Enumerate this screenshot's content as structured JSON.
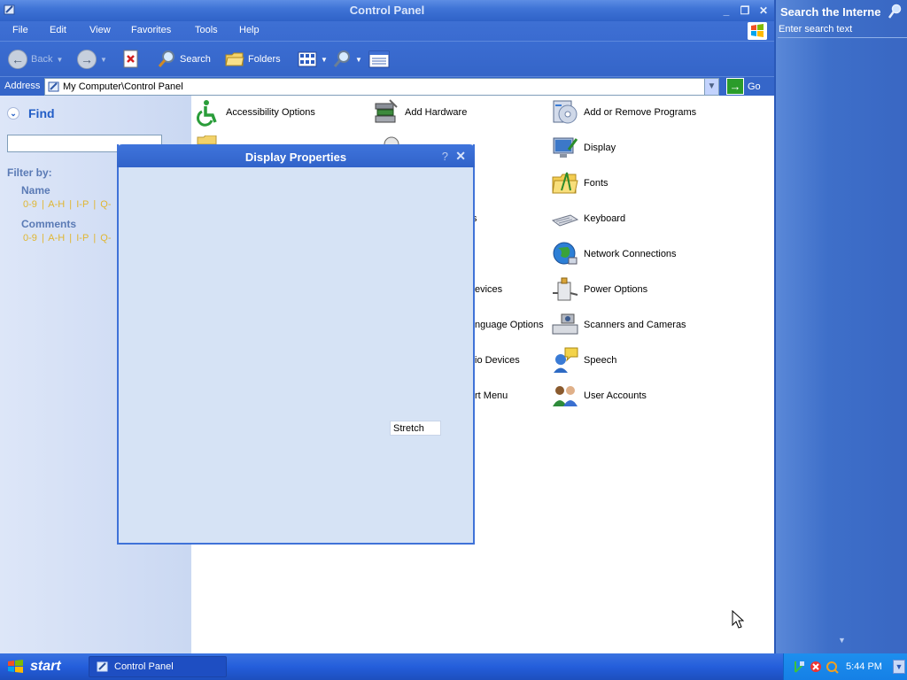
{
  "window": {
    "title": "Control Panel",
    "minimize": "_",
    "restore": "❐",
    "close": "✕"
  },
  "menu": [
    "File",
    "Edit",
    "View",
    "Favorites",
    "Tools",
    "Help"
  ],
  "toolbar": {
    "back": "Back",
    "search": "Search",
    "folders": "Folders"
  },
  "address": {
    "label": "Address",
    "value": "My Computer\\Control Panel",
    "go": "Go"
  },
  "left_pane": {
    "find": "Find",
    "filter_by": "Filter by:",
    "groups": [
      {
        "title": "Name",
        "links": [
          "0-9",
          "A-H",
          "I-P",
          "Q-"
        ]
      },
      {
        "title": "Comments",
        "links": [
          "0-9",
          "A-H",
          "I-P",
          "Q-"
        ]
      }
    ],
    "separator": "|"
  },
  "items": {
    "col1": [
      "Accessibility Options"
    ],
    "col2": [
      "Add Hardware",
      "evices",
      "nguage Options",
      "io Devices",
      "rt Menu"
    ],
    "col2_partial_s": "s",
    "col3": [
      "Add or Remove Programs",
      "Display",
      "Fonts",
      "Keyboard",
      "Network Connections",
      "Power Options",
      "Scanners and Cameras",
      "Speech",
      "User Accounts"
    ]
  },
  "dialog": {
    "title": "Display Properties",
    "help": "?",
    "close": "✕",
    "stretch": "Stretch"
  },
  "search_pane": {
    "title": "Search the Interne",
    "placeholder": "Enter search text",
    "scroll_glyph": "▼"
  },
  "taskbar": {
    "start": "start",
    "task": "Control Panel",
    "clock": "5:44 PM"
  }
}
